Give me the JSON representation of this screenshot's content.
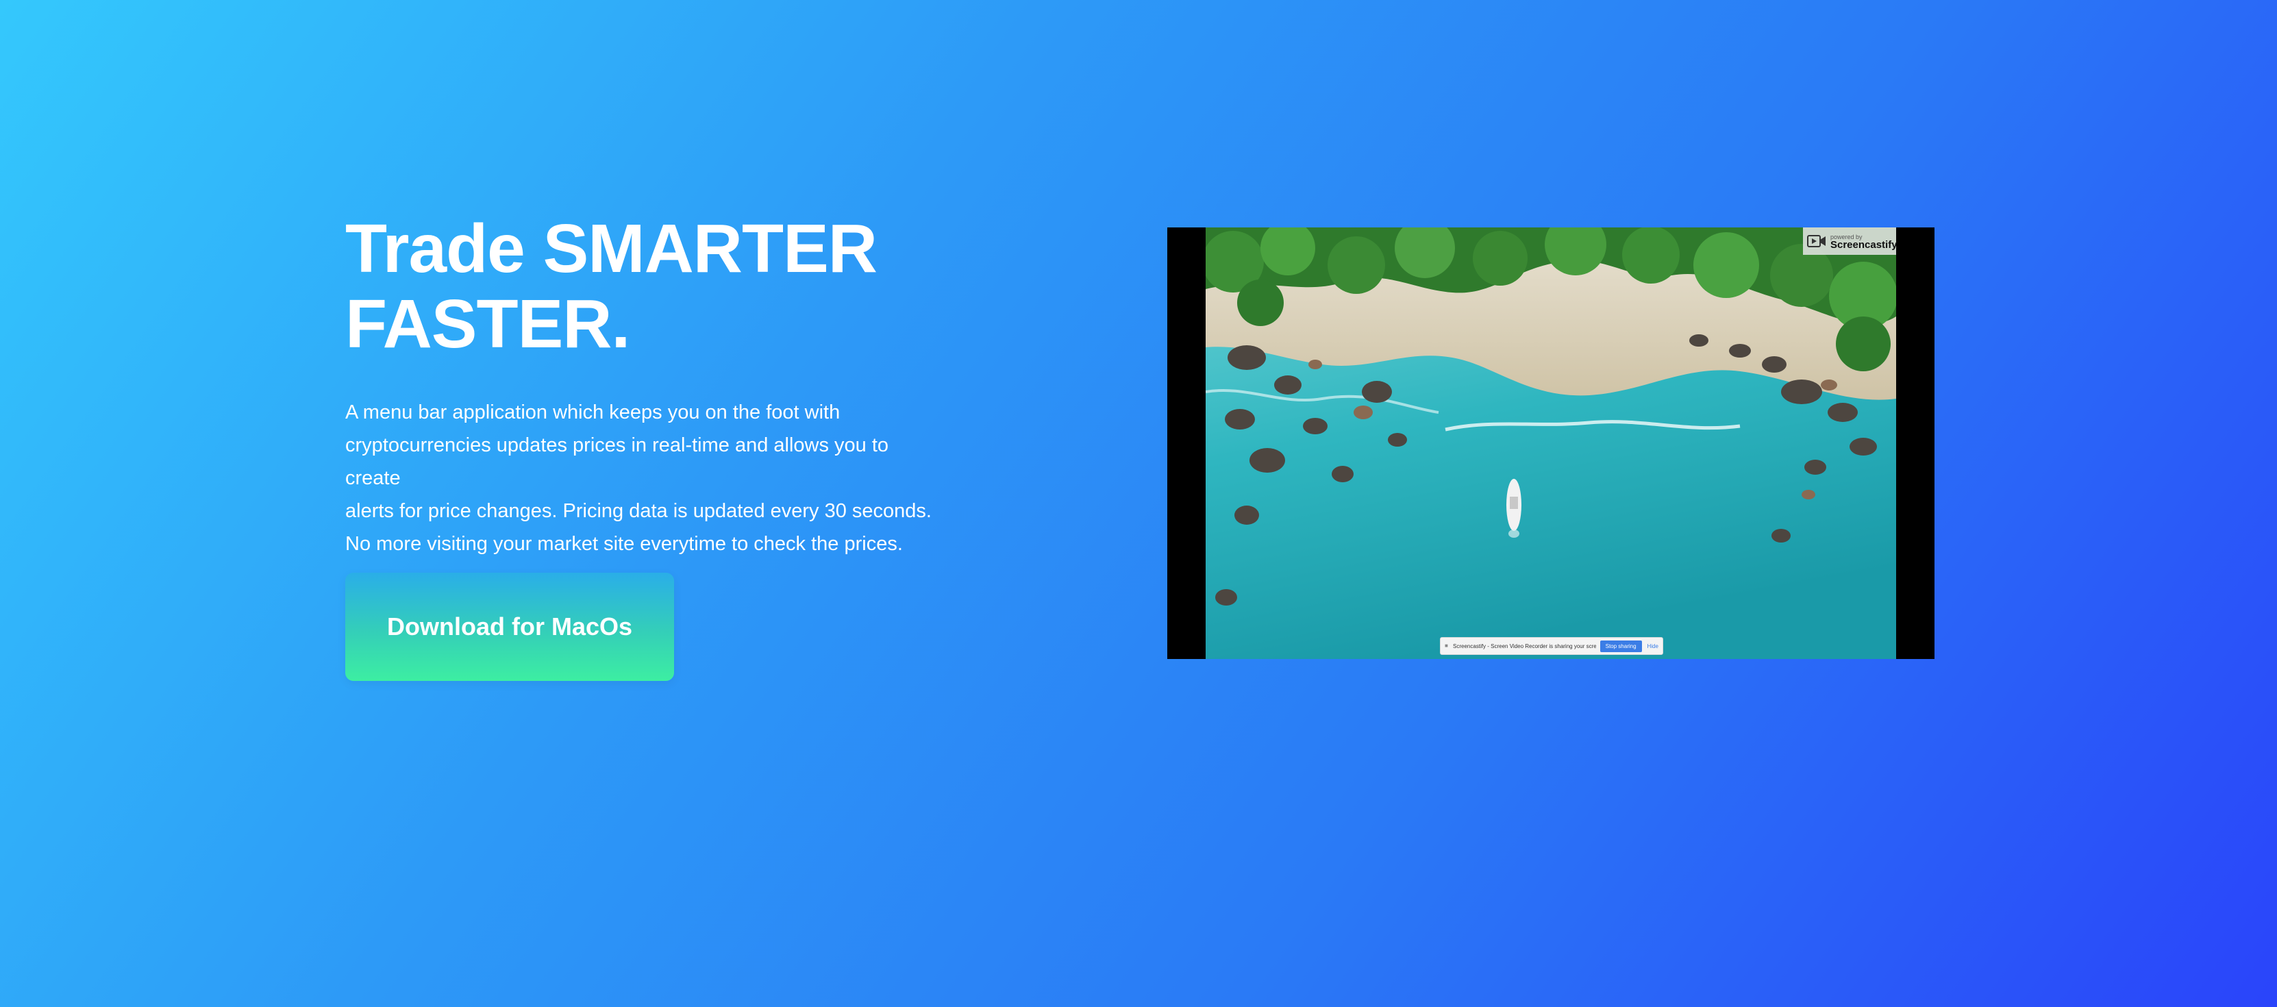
{
  "hero": {
    "headline_line1": "Trade SMARTER",
    "headline_line2": "FASTER.",
    "description_lines": [
      "A menu bar application which keeps you on the foot with",
      "cryptocurrencies updates prices in real-time and allows you to create",
      "alerts for price changes. Pricing data is updated every 30 seconds.",
      "No more visiting your market site everytime to check the prices."
    ],
    "download_label": "Download for MacOs"
  },
  "video": {
    "watermark_small": "powered by",
    "watermark_brand": "Screencastify",
    "share_text": "Screencastify - Screen Video Recorder is sharing your screen.",
    "stop_label": "Stop sharing",
    "hide_label": "Hide",
    "icons": {
      "watermark": "screencastify-logo-icon",
      "share": "screen-share-icon"
    }
  },
  "colors": {
    "gradient_start": "#34c8fc",
    "gradient_end": "#2a44fa",
    "button_top": "#2aaee8",
    "button_bottom": "#3deea2"
  }
}
